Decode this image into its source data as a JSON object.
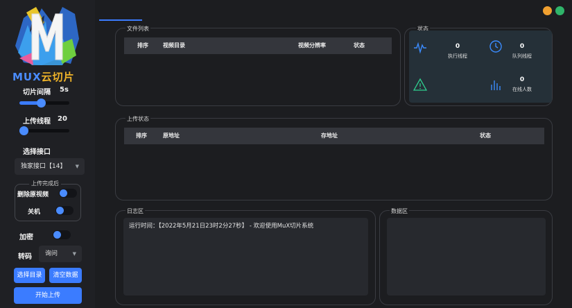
{
  "sidebar": {
    "logo_text_latin": "MUX",
    "logo_text_cn": "云切片",
    "slice_interval": {
      "label": "切片间隔",
      "value": "5s",
      "level": 0.42
    },
    "upload_threads": {
      "label": "上传线程",
      "value": "20",
      "level": 0.0
    },
    "interface": {
      "label": "选择接口",
      "selected": "独家接口【14】"
    },
    "after_upload": {
      "title": "上传完成后",
      "delete_label": "删除原视频",
      "delete_on": false,
      "shutdown_label": "关机",
      "shutdown_on": false
    },
    "encrypt": {
      "label": "加密",
      "on": false
    },
    "transcode": {
      "label": "转码",
      "selected": "询问"
    },
    "buttons": {
      "choose_dir": "选择目录",
      "clear_data": "清空数据",
      "start_upload": "开始上传"
    }
  },
  "main": {
    "file_list": {
      "title": "文件列表",
      "columns": [
        "排序",
        "视频目录",
        "视频分辨率",
        "状态"
      ]
    },
    "status": {
      "title": "状态",
      "running_threads": {
        "value": "0",
        "label": "执行线程"
      },
      "queued_threads": {
        "value": "0",
        "label": "队列线程"
      },
      "online_users": {
        "value": "0",
        "label": "在线人数"
      }
    },
    "upload_status": {
      "title": "上传状态",
      "columns": [
        "排序",
        "原地址",
        "存地址",
        "状态"
      ]
    },
    "log": {
      "title": "日志区",
      "line": "运行时间：【2022年5月21日23时2分27秒】 - 欢迎使用MuX切片系统"
    },
    "data_area": {
      "title": "数据区"
    }
  },
  "colors": {
    "accent": "#3b7cff",
    "window_min": "#f0a030",
    "window_max": "#2fb56a",
    "stat_bg": "#253038",
    "logo_cn": "#f0b429"
  },
  "icons": [
    "pulse-icon",
    "clock-icon",
    "warning-icon",
    "bar-chart-icon",
    "chevron-down-icon"
  ]
}
